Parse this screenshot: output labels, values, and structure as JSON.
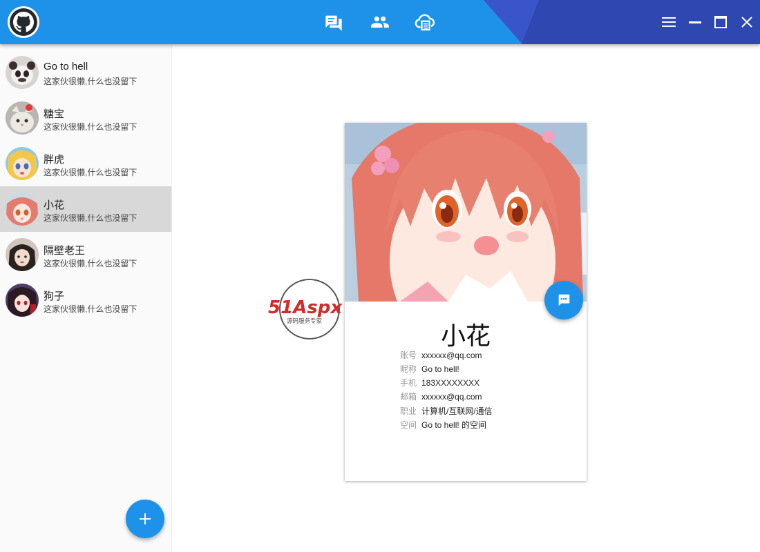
{
  "header": {
    "nav": [
      {
        "icon": "chat-icon"
      },
      {
        "icon": "contacts-icon"
      },
      {
        "icon": "cloud-icon"
      }
    ],
    "window_controls": [
      "menu-icon",
      "minimize-icon",
      "maximize-icon",
      "close-icon"
    ]
  },
  "contacts": [
    {
      "name": "Go to hell",
      "signature": "这家伙很懒,什么也没留下"
    },
    {
      "name": "糖宝",
      "signature": "这家伙很懒,什么也没留下"
    },
    {
      "name": "胖虎",
      "signature": "这家伙很懒,什么也没留下"
    },
    {
      "name": "小花",
      "signature": "这家伙很懒,什么也没留下",
      "selected": true
    },
    {
      "name": "隔壁老王",
      "signature": "这家伙很懒,什么也没留下"
    },
    {
      "name": "狗子",
      "signature": "这家伙很懒,什么也没留下"
    }
  ],
  "profile": {
    "name": "小花",
    "fields": [
      {
        "label": "账号",
        "value": "xxxxxx@qq.com"
      },
      {
        "label": "昵称",
        "value": "Go to hell!"
      },
      {
        "label": "手机",
        "value": "183XXXXXXXX"
      },
      {
        "label": "邮箱",
        "value": "xxxxxx@qq.com"
      },
      {
        "label": "职业",
        "value": "计算机/互联网/通信"
      },
      {
        "label": "空间",
        "value": "Go to hell! 的空间"
      }
    ]
  },
  "watermark": {
    "brand": "51Aspx",
    "slogan": "源码服务专家"
  },
  "colors": {
    "primary": "#1e92e8",
    "accent": "#3a55c9",
    "selected": "#d8d8d8"
  }
}
